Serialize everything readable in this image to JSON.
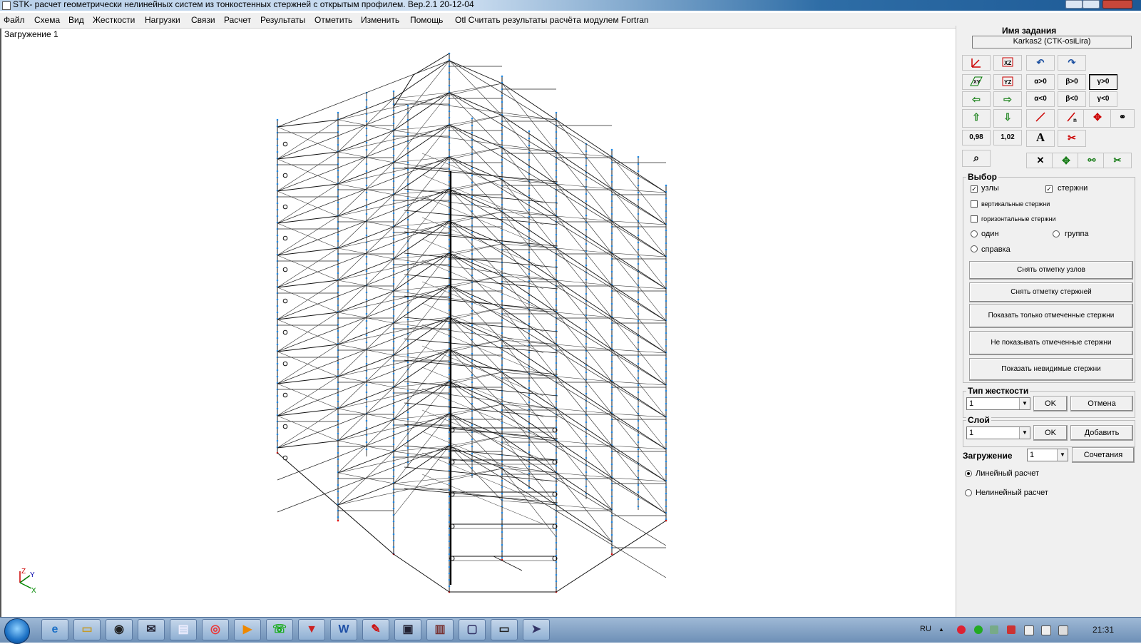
{
  "window": {
    "title": "STK- расчет геометрически нелинейных систем  из тонкостенных стержней с открытым профилем. Вер.2.1  20-12-04"
  },
  "menu": [
    "Файл",
    "Схема",
    "Вид",
    "Жесткости",
    "Нагрузки",
    "Связи",
    "Расчет",
    "Результаты",
    "Отметить",
    "Изменить",
    "Помощь",
    "Otl Считать результаты расчёта модулем Fortran"
  ],
  "canvas": {
    "load_label": "Загружение  1",
    "axis_labels": {
      "z": "Z",
      "y": "Y",
      "x": "X"
    }
  },
  "panel": {
    "task_name_title": "Имя задания",
    "task_name_value": "Karkas2  (CTK-osiLira)",
    "toolbar": {
      "alpha_pos": "α>0",
      "beta_pos": "β>0",
      "gamma_pos": "γ>0",
      "alpha_neg": "α<0",
      "beta_neg": "β<0",
      "gamma_neg": "γ<0",
      "scale_down": "0,98",
      "scale_up": "1,02",
      "text_tool": "A"
    },
    "selection": {
      "title": "Выбор",
      "nodes": {
        "label": "узлы",
        "checked": true
      },
      "bars": {
        "label": "стержни",
        "checked": true
      },
      "vertical_bars": {
        "label": "вертикальные стержни",
        "checked": false
      },
      "horizontal_bars": {
        "label": "горизонтальные стержни",
        "checked": false
      },
      "mode_one": "один",
      "mode_group": "группа",
      "mode_info": "справка",
      "buttons": {
        "unmark_nodes": "Снять отметку узлов",
        "unmark_bars": "Снять отметку стержней",
        "show_marked_only": "Показать только отмеченные стержни",
        "hide_marked": "Не показывать отмеченные стержни",
        "show_hidden": "Показать невидимые стержни"
      }
    },
    "stiffness": {
      "title": "Тип жесткости",
      "value": "1",
      "ok": "OK",
      "cancel": "Отмена"
    },
    "layer": {
      "title": "Слой",
      "value": "1",
      "ok": "OK",
      "add": "Добавить"
    },
    "loading": {
      "label": "Загружение",
      "value": "1",
      "combos": "Сочетания"
    },
    "analysis": {
      "linear": "Линейный расчет",
      "nonlinear": "Нелинейный расчет",
      "selected": "linear"
    }
  },
  "taskbar": {
    "language": "RU",
    "clock": "21:31",
    "apps": [
      "ie-icon",
      "folder-icon",
      "media-icon",
      "mail-icon",
      "notepad-icon",
      "chrome-icon",
      "player-icon",
      "messenger-icon",
      "antivirus-icon",
      "word-icon",
      "pdf-icon",
      "floppy-icon",
      "archive-icon",
      "screen-icon",
      "window-icon",
      "stk-app-icon"
    ]
  }
}
